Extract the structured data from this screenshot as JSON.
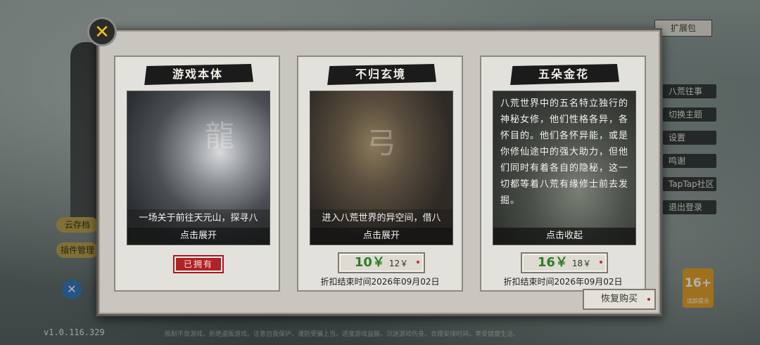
{
  "background": {
    "version": "v1.0.116.329",
    "health_tip": "抵制不良游戏，拒绝盗版游戏。注意自我保护，谨防受骗上当。适度游戏益脑，沉迷游戏伤身。合理安排时间，享受健康生活。",
    "top_right_tag": "扩展包",
    "right_menu": [
      "八荒往事",
      "切换主题",
      "设置",
      "鸣谢",
      "TapTap社区",
      "退出登录"
    ],
    "left_buttons": [
      "云存档",
      "插件管理"
    ],
    "age_rating": "16+",
    "age_rating_sub": "适龄提示"
  },
  "modal": {
    "close_label": "✕",
    "restore_label": "恢复购买",
    "cards": [
      {
        "title": "游戏本体",
        "caption": "一场关于前往天元山，探寻八",
        "toggle": "点击展开",
        "owned_label": "已拥有"
      },
      {
        "title": "不归玄境",
        "caption": "进入八荒世界的异空间，借八",
        "toggle": "点击展开",
        "price_new": "10￥",
        "price_old": "12￥",
        "deadline": "折扣结束时间2026年09月02日"
      },
      {
        "title": "五朵金花",
        "description": "八荒世界中的五名特立独行的神秘女修，他们性格各异，各怀目的。他们各怀异能，或是你修仙途中的强大助力，但他们同时有着各自的隐秘，这一切都等着八荒有缘修士前去发掘。",
        "toggle": "点击收起",
        "price_new": "16￥",
        "price_old": "18￥",
        "deadline": "折扣结束时间2026年09月02日"
      }
    ]
  },
  "colors": {
    "price_green": "#2f7d2a",
    "close_icon": "#f0c21a",
    "owned_red": "#b02226"
  }
}
